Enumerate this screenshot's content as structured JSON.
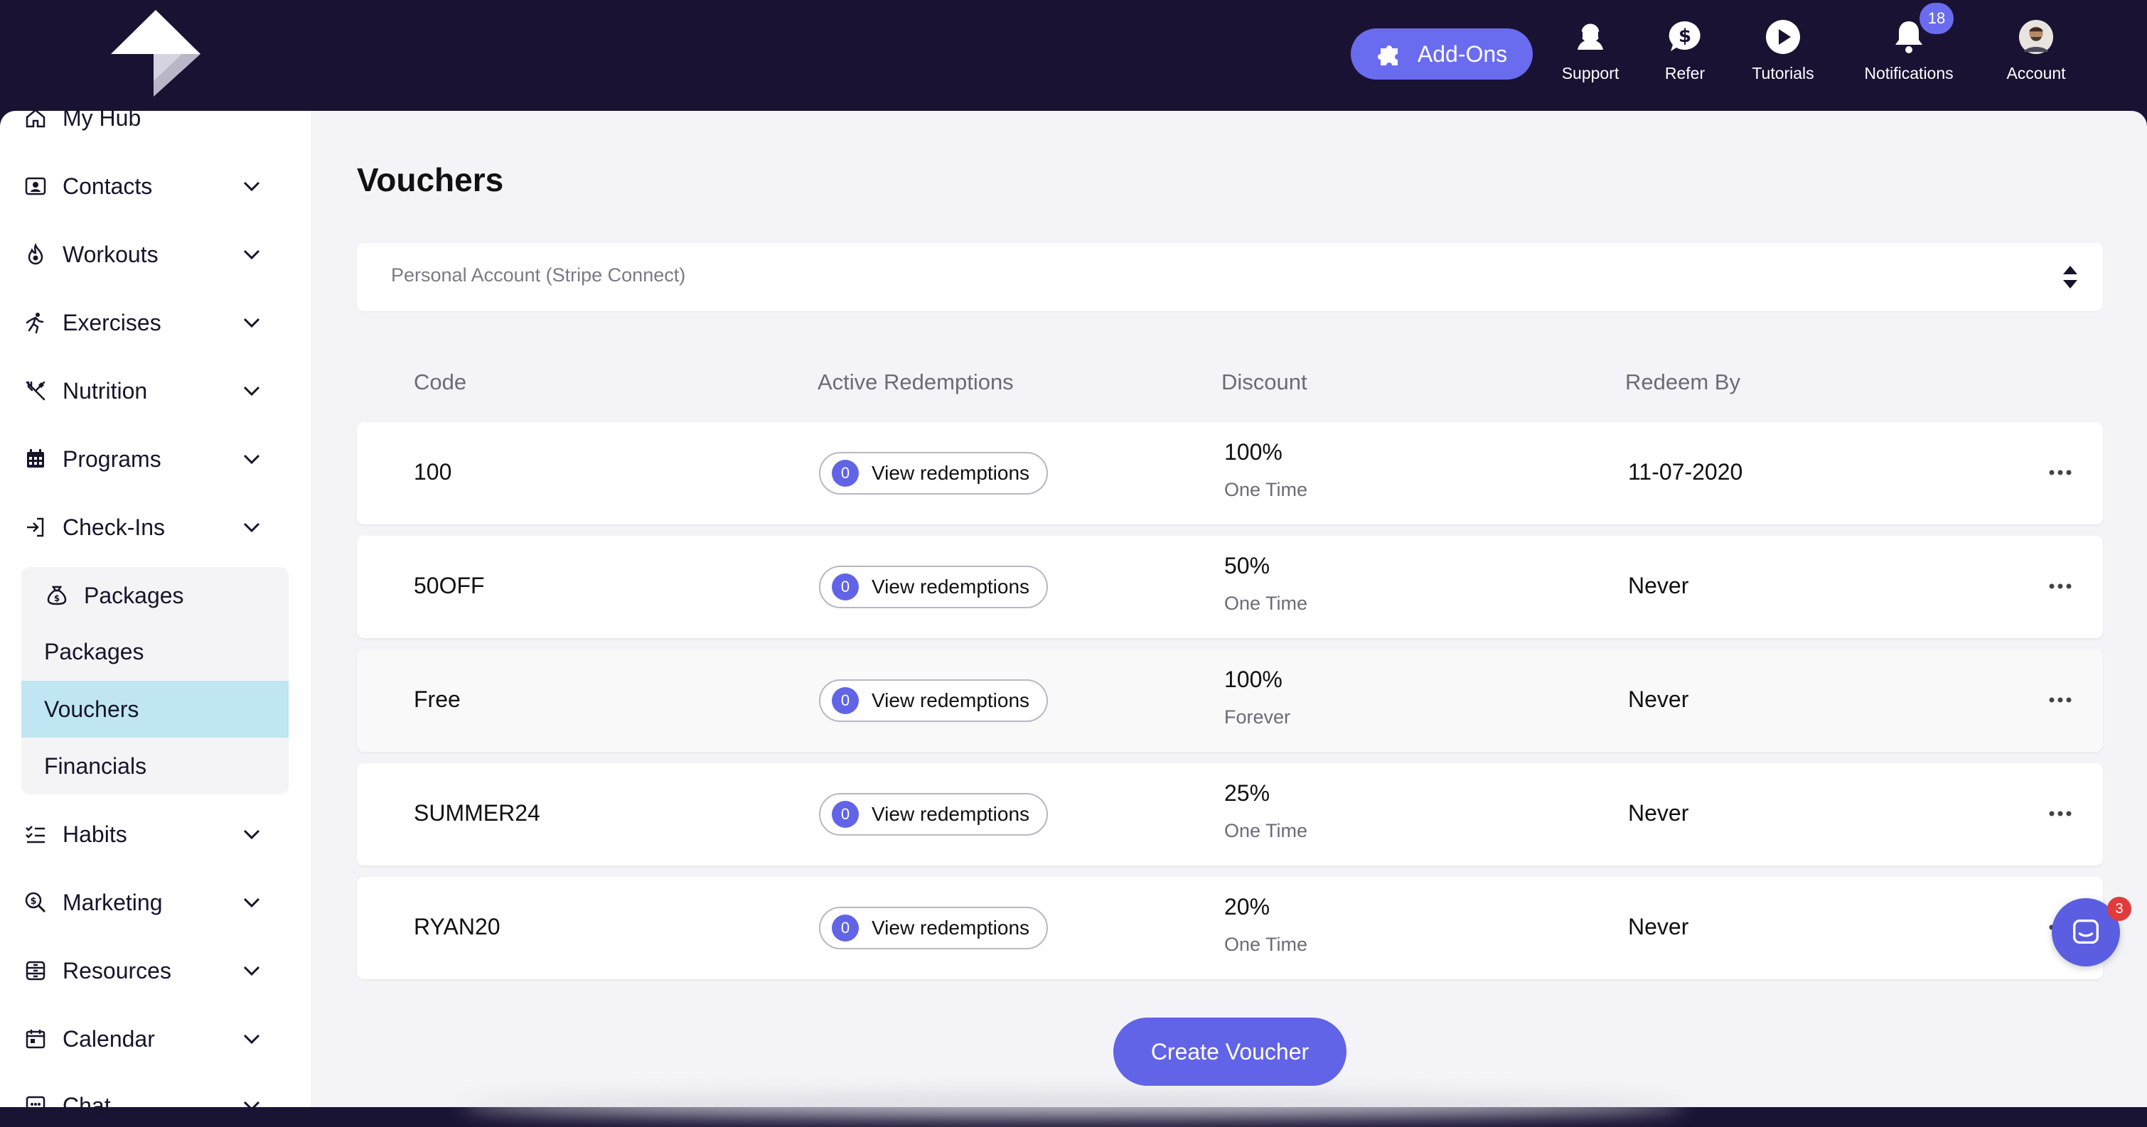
{
  "topbar": {
    "addons_label": "Add-Ons",
    "nav": [
      {
        "label": "Support",
        "icon": "support-headset-icon"
      },
      {
        "label": "Refer",
        "icon": "dollar-chat-icon"
      },
      {
        "label": "Tutorials",
        "icon": "play-icon"
      },
      {
        "label": "Notifications",
        "icon": "bell-icon"
      },
      {
        "label": "Account",
        "icon": "avatar"
      }
    ],
    "notifications_count": "18"
  },
  "sidebar": {
    "items": [
      {
        "label": "My Hub",
        "icon": "home-icon"
      },
      {
        "label": "Contacts",
        "icon": "contact-card-icon"
      },
      {
        "label": "Workouts",
        "icon": "flame-icon"
      },
      {
        "label": "Exercises",
        "icon": "running-icon"
      },
      {
        "label": "Nutrition",
        "icon": "utensils-icon"
      },
      {
        "label": "Programs",
        "icon": "calendar-grid-icon"
      },
      {
        "label": "Check-Ins",
        "icon": "sign-in-icon"
      },
      {
        "label": "Packages",
        "icon": "money-bag-icon"
      },
      {
        "label": "Habits",
        "icon": "checklist-icon"
      },
      {
        "label": "Marketing",
        "icon": "search-dollar-icon"
      },
      {
        "label": "Resources",
        "icon": "archive-icon"
      },
      {
        "label": "Calendar",
        "icon": "calendar-icon"
      },
      {
        "label": "Chat",
        "icon": "chat-icon"
      }
    ],
    "packages_sub": [
      "Packages",
      "Vouchers",
      "Financials"
    ],
    "active_sub": "Vouchers"
  },
  "main": {
    "title": "Vouchers",
    "account_select": "Personal Account (Stripe Connect)",
    "columns": [
      "Code",
      "Active Redemptions",
      "Discount",
      "Redeem By"
    ],
    "view_label": "View redemptions",
    "rows": [
      {
        "code": "100",
        "count": "0",
        "discount": "100%",
        "duration": "One Time",
        "redeem_by": "11-07-2020"
      },
      {
        "code": "50OFF",
        "count": "0",
        "discount": "50%",
        "duration": "One Time",
        "redeem_by": "Never"
      },
      {
        "code": "Free",
        "count": "0",
        "discount": "100%",
        "duration": "Forever",
        "redeem_by": "Never"
      },
      {
        "code": "SUMMER24",
        "count": "0",
        "discount": "25%",
        "duration": "One Time",
        "redeem_by": "Never"
      },
      {
        "code": "RYAN20",
        "count": "0",
        "discount": "20%",
        "duration": "One Time",
        "redeem_by": "Never"
      }
    ],
    "create_label": "Create Voucher"
  },
  "chat": {
    "badge": "3"
  },
  "colors": {
    "topbar": "#191233",
    "accent": "#6164e6",
    "active_sub": "#bfe6f2",
    "badge_red": "#e23b3b"
  }
}
